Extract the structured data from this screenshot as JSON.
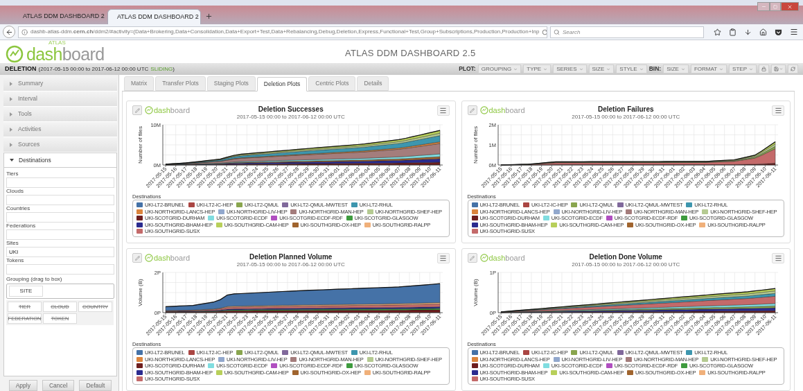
{
  "browser": {
    "tabs": [
      {
        "title": "ATLAS DDM DASHBOARD 2",
        "selected": false
      },
      {
        "title": "ATLAS DDM DASHBOARD 2",
        "selected": true
      }
    ],
    "url": "dashb-atlas-ddm.**cern.ch**/ddm2/#activity=(Data+Brokering,Data+Consolidation,Data+Export+Test,Data+Rebalancing,Debug,Deletion,Express,Functional+Test,Group+Subscriptions,Production,Production+Inp",
    "search": {
      "placeholder": "Search"
    }
  },
  "header": {
    "logo": {
      "superscript": "ATLAS",
      "accent": "dash",
      "rest": "board"
    },
    "title": "ATLAS DDM DASHBOARD 2.5"
  },
  "period": {
    "label": "DELETION",
    "range": "(2017-05-15 00:00 to 2017-06-12 00:00 UTC",
    "mode": "SLIDING",
    "close": ")"
  },
  "toolbar": {
    "plot_label": "PLOT:",
    "plot_menus": [
      "GROUPING",
      "TYPE",
      "SERIES",
      "SIZE",
      "STYLE"
    ],
    "bin_label": "BIN:",
    "bin_menus": [
      "SIZE",
      "FORMAT",
      "STEP"
    ]
  },
  "sidebar": {
    "sections": [
      {
        "label": "Summary",
        "expanded": false
      },
      {
        "label": "Interval",
        "expanded": false
      },
      {
        "label": "Tools",
        "expanded": false
      },
      {
        "label": "Activities",
        "expanded": false
      },
      {
        "label": "Sources",
        "expanded": false
      },
      {
        "label": "Destinations",
        "expanded": true
      }
    ],
    "filters": [
      {
        "label": "Tiers"
      },
      {
        "label": "Clouds"
      },
      {
        "label": "Countries"
      },
      {
        "label": "Federations"
      },
      {
        "label": "Sites",
        "value": "UKI"
      },
      {
        "label": "Tokens"
      }
    ],
    "grouping": {
      "label": "Grouping (drag to box)",
      "chosen": [
        "SITE"
      ],
      "options": [
        {
          "label": "TIER",
          "disabled": true
        },
        {
          "label": "CLOUD",
          "disabled": true
        },
        {
          "label": "COUNTRY",
          "disabled": true
        },
        {
          "label": "FEDERATION",
          "disabled": true
        },
        {
          "label": "TOKEN",
          "disabled": true
        }
      ]
    },
    "buttons": [
      "Apply",
      "Cancel",
      "Default"
    ]
  },
  "tabs": [
    {
      "label": "Matrix",
      "selected": false
    },
    {
      "label": "Transfer Plots",
      "selected": false
    },
    {
      "label": "Staging Plots",
      "selected": false
    },
    {
      "label": "Deletion Plots",
      "selected": true
    },
    {
      "label": "Centric Plots",
      "selected": false
    },
    {
      "label": "Details",
      "selected": false
    }
  ],
  "charts": [
    {
      "logo": {
        "accent": "dash",
        "rest": "board"
      },
      "title": "Deletion Successes",
      "subtitle": "2017-05-15 00:00 to 2017-06-12 00:00 UTC",
      "ylabel": "Number of files",
      "yticks": [
        "10M",
        "0M"
      ],
      "categories": [
        "2017-05-15",
        "2017-05-16",
        "2017-05-17",
        "2017-05-18",
        "2017-05-19",
        "2017-05-20",
        "2017-05-21",
        "2017-05-22",
        "2017-05-23",
        "2017-05-24",
        "2017-05-25",
        "2017-05-26",
        "2017-05-27",
        "2017-05-28",
        "2017-05-29",
        "2017-05-30",
        "2017-05-31",
        "2017-06-01",
        "2017-06-02",
        "2017-06-03",
        "2017-06-04",
        "2017-06-05",
        "2017-06-06",
        "2017-06-07",
        "2017-06-08",
        "2017-06-09",
        "2017-06-10",
        "2017-06-11"
      ],
      "legend_title": "Destinations",
      "legend": [
        [
          {
            "label": "UKI-LT2-BRUNEL",
            "color": "#4572a7"
          },
          {
            "label": "UKI-LT2-IC-HEP",
            "color": "#aa4643"
          },
          {
            "label": "UKI-LT2-QMUL",
            "color": "#89a54e"
          },
          {
            "label": "UKI-LT2-QMUL-MWTEST",
            "color": "#80699b"
          },
          {
            "label": "UKI-LT2-RHUL",
            "color": "#3d96ae"
          }
        ],
        [
          {
            "label": "UKI-NORTHGRID-LANCS-HEP",
            "color": "#db843d"
          },
          {
            "label": "UKI-NORTHGRID-LIV-HEP",
            "color": "#92a8cd"
          },
          {
            "label": "UKI-NORTHGRID-MAN-HEP",
            "color": "#a47d7c"
          },
          {
            "label": "UKI-NORTHGRID-SHEF-HEP",
            "color": "#b5ca92"
          }
        ],
        [
          {
            "label": "UKI-SCOTGRID-DURHAM",
            "color": "#6e1e1e"
          },
          {
            "label": "UKI-SCOTGRID-ECDF",
            "color": "#80dde0"
          },
          {
            "label": "UKI-SCOTGRID-ECDF-RDF",
            "color": "#b04fc0"
          },
          {
            "label": "UKI-SCOTGRID-GLASGOW",
            "color": "#3e9b3e"
          }
        ],
        [
          {
            "label": "UKI-SOUTHGRID-BHAM-HEP",
            "color": "#2b2b8f"
          },
          {
            "label": "UKI-SOUTHGRID-CAM-HEP",
            "color": "#b8cf5a"
          },
          {
            "label": "UKI-SOUTHGRID-OX-HEP",
            "color": "#a0642e"
          },
          {
            "label": "UKI-SOUTHGRID-RALPP",
            "color": "#f0b07a"
          }
        ],
        [
          {
            "label": "UKI-SOUTHGRID-SUSX",
            "color": "#c46a6a"
          }
        ]
      ]
    },
    {
      "logo": {
        "accent": "dash",
        "rest": "board"
      },
      "title": "Deletion Failures",
      "subtitle": "2017-05-15 00:00 to 2017-06-12 00:00 UTC",
      "ylabel": "Number of files",
      "yticks": [
        "2M",
        "1M",
        "0M"
      ],
      "categories": [
        "2017-05-15",
        "2017-05-16",
        "2017-05-17",
        "2017-05-18",
        "2017-05-19",
        "2017-05-20",
        "2017-05-21",
        "2017-05-22",
        "2017-05-23",
        "2017-05-24",
        "2017-05-25",
        "2017-05-26",
        "2017-05-27",
        "2017-05-28",
        "2017-05-29",
        "2017-05-30",
        "2017-05-31",
        "2017-06-01",
        "2017-06-02",
        "2017-06-03",
        "2017-06-04",
        "2017-06-05",
        "2017-06-06",
        "2017-06-07",
        "2017-06-08",
        "2017-06-09",
        "2017-06-10",
        "2017-06-11"
      ],
      "legend_title": "Destinations",
      "legend": [
        [
          {
            "label": "UKI-LT2-BRUNEL",
            "color": "#4572a7"
          },
          {
            "label": "UKI-LT2-IC-HEP",
            "color": "#aa4643"
          },
          {
            "label": "UKI-LT2-QMUL",
            "color": "#89a54e"
          },
          {
            "label": "UKI-LT2-QMUL-MWTEST",
            "color": "#80699b"
          },
          {
            "label": "UKI-LT2-RHUL",
            "color": "#3d96ae"
          }
        ],
        [
          {
            "label": "UKI-NORTHGRID-LANCS-HEP",
            "color": "#db843d"
          },
          {
            "label": "UKI-NORTHGRID-LIV-HEP",
            "color": "#92a8cd"
          },
          {
            "label": "UKI-NORTHGRID-MAN-HEP",
            "color": "#a47d7c"
          },
          {
            "label": "UKI-NORTHGRID-SHEF-HEP",
            "color": "#b5ca92"
          }
        ],
        [
          {
            "label": "UKI-SCOTGRID-DURHAM",
            "color": "#6e1e1e"
          },
          {
            "label": "UKI-SCOTGRID-ECDF",
            "color": "#80dde0"
          },
          {
            "label": "UKI-SCOTGRID-ECDF-RDF",
            "color": "#b04fc0"
          },
          {
            "label": "UKI-SCOTGRID-GLASGOW",
            "color": "#3e9b3e"
          }
        ],
        [
          {
            "label": "UKI-SOUTHGRID-BHAM-HEP",
            "color": "#2b2b8f"
          },
          {
            "label": "UKI-SOUTHGRID-CAM-HEP",
            "color": "#b8cf5a"
          },
          {
            "label": "UKI-SOUTHGRID-OX-HEP",
            "color": "#a0642e"
          },
          {
            "label": "UKI-SOUTHGRID-RALPP",
            "color": "#f0b07a"
          }
        ],
        [
          {
            "label": "UKI-SOUTHGRID-SUSX",
            "color": "#c46a6a"
          }
        ]
      ]
    },
    {
      "logo": {
        "accent": "dash",
        "rest": "board"
      },
      "title": "Deletion Planned Volume",
      "subtitle": "2017-05-15 00:00 to 2017-06-12 00:00 UTC",
      "ylabel": "Volume (B)",
      "yticks": [
        "2P",
        "0P"
      ],
      "categories": [
        "2017-05-15",
        "2017-05-16",
        "2017-05-17",
        "2017-05-18",
        "2017-05-19",
        "2017-05-20",
        "2017-05-21",
        "2017-05-22",
        "2017-05-23",
        "2017-05-24",
        "2017-05-25",
        "2017-05-26",
        "2017-05-27",
        "2017-05-28",
        "2017-05-29",
        "2017-05-30",
        "2017-05-31",
        "2017-06-01",
        "2017-06-02",
        "2017-06-03",
        "2017-06-04",
        "2017-06-05",
        "2017-06-06",
        "2017-06-07",
        "2017-06-08",
        "2017-06-09",
        "2017-06-10",
        "2017-06-11"
      ],
      "legend_title": "Destinations",
      "legend": [
        [
          {
            "label": "UKI-LT2-BRUNEL",
            "color": "#4572a7"
          },
          {
            "label": "UKI-LT2-IC-HEP",
            "color": "#aa4643"
          },
          {
            "label": "UKI-LT2-QMUL",
            "color": "#89a54e"
          },
          {
            "label": "UKI-LT2-QMUL-MWTEST",
            "color": "#80699b"
          },
          {
            "label": "UKI-LT2-RHUL",
            "color": "#3d96ae"
          }
        ],
        [
          {
            "label": "UKI-NORTHGRID-LANCS-HEP",
            "color": "#db843d"
          },
          {
            "label": "UKI-NORTHGRID-LIV-HEP",
            "color": "#92a8cd"
          },
          {
            "label": "UKI-NORTHGRID-MAN-HEP",
            "color": "#a47d7c"
          },
          {
            "label": "UKI-NORTHGRID-SHEF-HEP",
            "color": "#b5ca92"
          }
        ],
        [
          {
            "label": "UKI-SCOTGRID-DURHAM",
            "color": "#6e1e1e"
          },
          {
            "label": "UKI-SCOTGRID-ECDF",
            "color": "#80dde0"
          },
          {
            "label": "UKI-SCOTGRID-ECDF-RDF",
            "color": "#b04fc0"
          },
          {
            "label": "UKI-SCOTGRID-GLASGOW",
            "color": "#3e9b3e"
          }
        ],
        [
          {
            "label": "UKI-SOUTHGRID-BHAM-HEP",
            "color": "#2b2b8f"
          },
          {
            "label": "UKI-SOUTHGRID-CAM-HEP",
            "color": "#b8cf5a"
          },
          {
            "label": "UKI-SOUTHGRID-OX-HEP",
            "color": "#a0642e"
          },
          {
            "label": "UKI-SOUTHGRID-RALPP",
            "color": "#f0b07a"
          }
        ],
        [
          {
            "label": "UKI-SOUTHGRID-SUSX",
            "color": "#c46a6a"
          }
        ]
      ]
    },
    {
      "logo": {
        "accent": "dash",
        "rest": "board"
      },
      "title": "Deletion Done Volume",
      "subtitle": "2017-05-15 00:00 to 2017-06-12 00:00 UTC",
      "ylabel": "Volume (B)",
      "yticks": [
        "1P",
        "0P"
      ],
      "categories": [
        "2017-05-15",
        "2017-05-16",
        "2017-05-17",
        "2017-05-18",
        "2017-05-19",
        "2017-05-20",
        "2017-05-21",
        "2017-05-22",
        "2017-05-23",
        "2017-05-24",
        "2017-05-25",
        "2017-05-26",
        "2017-05-27",
        "2017-05-28",
        "2017-05-29",
        "2017-05-30",
        "2017-05-31",
        "2017-06-01",
        "2017-06-02",
        "2017-06-03",
        "2017-06-04",
        "2017-06-05",
        "2017-06-06",
        "2017-06-07",
        "2017-06-08",
        "2017-06-09",
        "2017-06-10",
        "2017-06-11"
      ],
      "legend_title": "Destinations",
      "legend": [
        [
          {
            "label": "UKI-LT2-BRUNEL",
            "color": "#4572a7"
          },
          {
            "label": "UKI-LT2-IC-HEP",
            "color": "#aa4643"
          },
          {
            "label": "UKI-LT2-QMUL",
            "color": "#89a54e"
          },
          {
            "label": "UKI-LT2-QMUL-MWTEST",
            "color": "#80699b"
          },
          {
            "label": "UKI-LT2-RHUL",
            "color": "#3d96ae"
          }
        ],
        [
          {
            "label": "UKI-NORTHGRID-LANCS-HEP",
            "color": "#db843d"
          },
          {
            "label": "UKI-NORTHGRID-LIV-HEP",
            "color": "#92a8cd"
          },
          {
            "label": "UKI-NORTHGRID-MAN-HEP",
            "color": "#a47d7c"
          },
          {
            "label": "UKI-NORTHGRID-SHEF-HEP",
            "color": "#b5ca92"
          }
        ],
        [
          {
            "label": "UKI-SCOTGRID-DURHAM",
            "color": "#6e1e1e"
          },
          {
            "label": "UKI-SCOTGRID-ECDF",
            "color": "#80dde0"
          },
          {
            "label": "UKI-SCOTGRID-ECDF-RDF",
            "color": "#b04fc0"
          },
          {
            "label": "UKI-SCOTGRID-GLASGOW",
            "color": "#3e9b3e"
          }
        ],
        [
          {
            "label": "UKI-SOUTHGRID-BHAM-HEP",
            "color": "#2b2b8f"
          },
          {
            "label": "UKI-SOUTHGRID-CAM-HEP",
            "color": "#b8cf5a"
          },
          {
            "label": "UKI-SOUTHGRID-OX-HEP",
            "color": "#a0642e"
          },
          {
            "label": "UKI-SOUTHGRID-RALPP",
            "color": "#f0b07a"
          }
        ],
        [
          {
            "label": "UKI-SOUTHGRID-SUSX",
            "color": "#c46a6a"
          }
        ]
      ]
    }
  ]
}
